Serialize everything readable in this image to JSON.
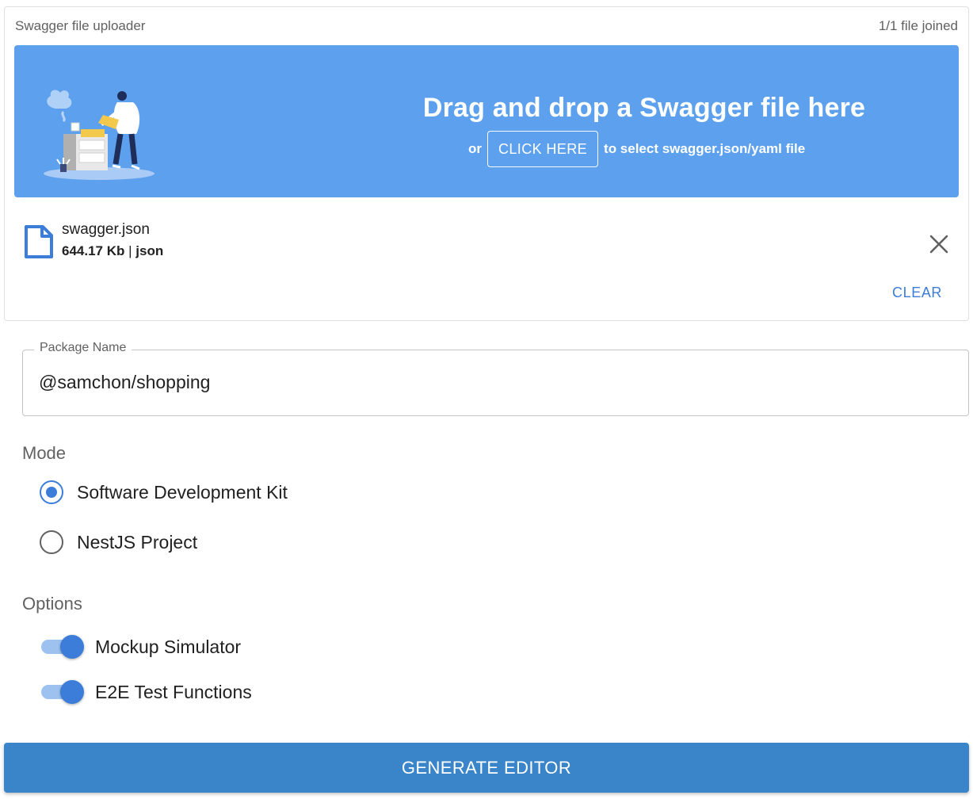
{
  "uploader": {
    "title": "Swagger file uploader",
    "count": "1/1 file joined",
    "dropzone": {
      "title": "Drag and drop a Swagger file here",
      "prefix": "or",
      "button_label": "CLICK HERE",
      "suffix": "to select swagger.json/yaml file",
      "background_color": "#5da1ee"
    },
    "file": {
      "name": "swagger.json",
      "size": "644.17 Kb",
      "separator": "|",
      "type": "json",
      "icon": "file-icon",
      "remove_icon": "close-icon"
    },
    "clear_label": "CLEAR"
  },
  "package": {
    "label": "Package Name",
    "value": "@samchon/shopping"
  },
  "mode": {
    "title": "Mode",
    "options": [
      {
        "label": "Software Development Kit",
        "checked": true
      },
      {
        "label": "NestJS Project",
        "checked": false
      }
    ]
  },
  "options": {
    "title": "Options",
    "switches": [
      {
        "label": "Mockup Simulator",
        "on": true
      },
      {
        "label": "E2E Test Functions",
        "on": true
      }
    ]
  },
  "generate_label": "GENERATE EDITOR",
  "colors": {
    "accent": "#3b7dd8",
    "primary_button": "#3a85c9"
  }
}
